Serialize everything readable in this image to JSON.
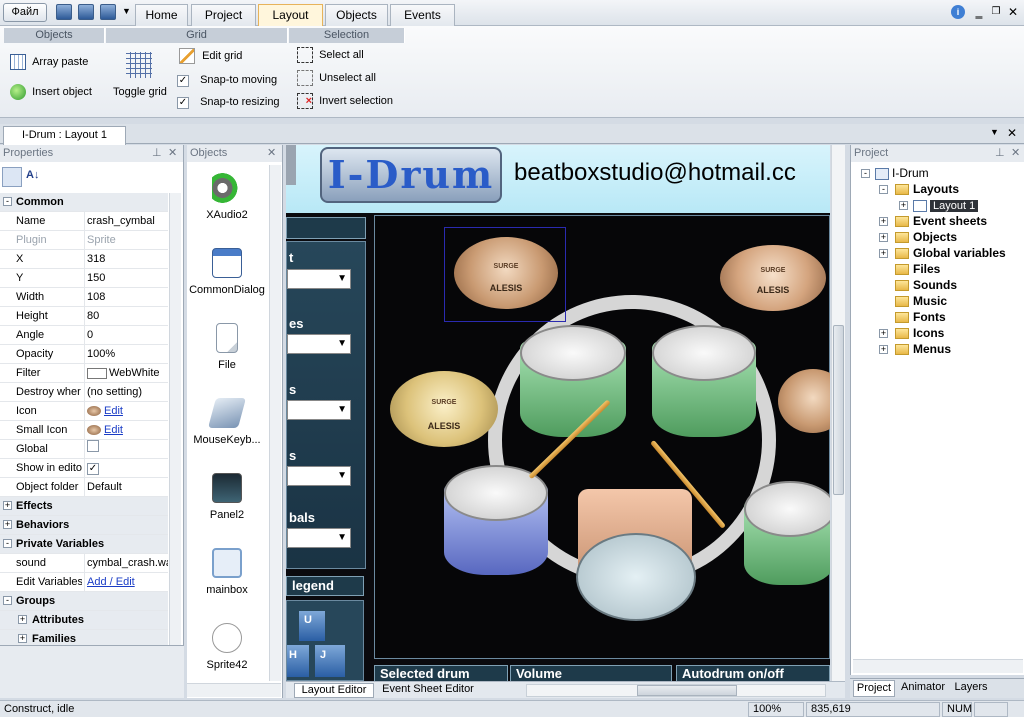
{
  "menu": {
    "file_label": "Файл"
  },
  "tabs": [
    "Home",
    "Project",
    "Layout",
    "Objects",
    "Events"
  ],
  "active_tab": "Layout",
  "ribbon": {
    "groups": [
      "Objects",
      "Grid",
      "Selection"
    ],
    "objects": {
      "array_paste": "Array paste",
      "insert_object": "Insert object"
    },
    "grid": {
      "toggle_grid": "Toggle grid",
      "edit_grid": "Edit grid",
      "snap_moving": "Snap-to moving",
      "snap_resizing": "Snap-to resizing"
    },
    "selection": {
      "select_all": "Select all",
      "unselect_all": "Unselect all",
      "invert_selection": "Invert selection"
    }
  },
  "document_tab": "I-Drum : Layout 1",
  "properties": {
    "title": "Properties",
    "rows": [
      {
        "type": "section",
        "label": "Common",
        "sign": "-"
      },
      {
        "label": "Name",
        "value": "crash_cymbal"
      },
      {
        "label": "Plugin",
        "value": "Sprite",
        "grey": true
      },
      {
        "label": "X",
        "value": "318"
      },
      {
        "label": "Y",
        "value": "150"
      },
      {
        "label": "Width",
        "value": "108"
      },
      {
        "label": "Height",
        "value": "80"
      },
      {
        "label": "Angle",
        "value": "0"
      },
      {
        "label": "Opacity",
        "value": "100%"
      },
      {
        "label": "Filter",
        "value": "WebWhite",
        "swatch": true
      },
      {
        "label": "Destroy wher",
        "value": "(no setting)"
      },
      {
        "label": "Icon",
        "value": "Edit",
        "link": true,
        "thumb": true
      },
      {
        "label": "Small Icon",
        "value": "Edit",
        "link": true,
        "thumb": true
      },
      {
        "label": "Global",
        "value": "",
        "check": ""
      },
      {
        "label": "Show in edito",
        "value": "",
        "check": "✓"
      },
      {
        "label": "Object folder",
        "value": "Default"
      },
      {
        "type": "section",
        "label": "Effects",
        "sign": "+"
      },
      {
        "type": "section",
        "label": "Behaviors",
        "sign": "+"
      },
      {
        "type": "section",
        "label": "Private Variables",
        "sign": "-"
      },
      {
        "label": "sound",
        "value": "cymbal_crash.wa"
      },
      {
        "label": "Edit Variables",
        "value": "Add / Edit",
        "link": true
      },
      {
        "type": "section",
        "label": "Groups",
        "sign": "-"
      },
      {
        "type": "subsection",
        "label": "Attributes",
        "sign": "+"
      },
      {
        "type": "subsection",
        "label": "Families",
        "sign": "+"
      }
    ]
  },
  "objects_panel": {
    "title": "Objects",
    "items": [
      {
        "label": "XAudio2",
        "icon": "speaker-icon"
      },
      {
        "label": "CommonDialog",
        "icon": "dialog-icon"
      },
      {
        "label": "File",
        "icon": "file-icon"
      },
      {
        "label": "MouseKeyb...",
        "icon": "mouse-keyboard-icon"
      },
      {
        "label": "Panel2",
        "icon": "panel-icon"
      },
      {
        "label": "mainbox",
        "icon": "box-icon"
      },
      {
        "label": "Sprite42",
        "icon": "sprite-icon"
      }
    ]
  },
  "canvas": {
    "logo_text": "I-Drum",
    "email": "beatboxstudio@hotmail.cc",
    "left_labels": [
      "t",
      "es",
      "s",
      "s",
      "bals"
    ],
    "legend_label": "legend",
    "keys": [
      "U",
      "H",
      "J"
    ],
    "bottom_labels": [
      "Selected drum",
      "Volume",
      "Autodrum on/off"
    ],
    "cymbal_text": "ALESIS",
    "cymbal_brand": "SURGE"
  },
  "editor_tabs": [
    "Layout Editor",
    "Event Sheet Editor"
  ],
  "project_panel": {
    "title": "Project",
    "root": "I-Drum",
    "nodes": [
      "Layouts",
      "Layout 1",
      "Event sheets",
      "Objects",
      "Global variables",
      "Files",
      "Sounds",
      "Music",
      "Fonts",
      "Icons",
      "Menus"
    ],
    "bottom_tabs": [
      "Project",
      "Animator",
      "Layers"
    ]
  },
  "status": {
    "text": "Construct, idle",
    "zoom": "100%",
    "coords": "835,619",
    "num": "NUM"
  },
  "colors": {
    "tab_active": "#fff6dc",
    "canvas_bg": "#0a0a0e",
    "link": "#1a3cc6"
  }
}
